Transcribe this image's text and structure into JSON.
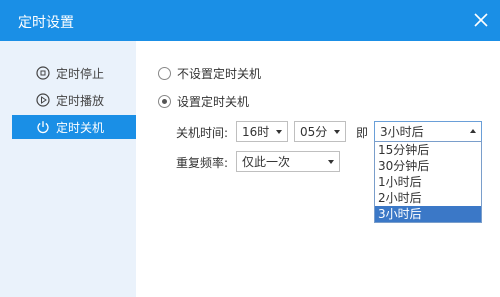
{
  "window": {
    "title": "定时设置"
  },
  "icons": {
    "close": "close-icon",
    "stop": "clock-stop-icon",
    "play": "play-clock-icon",
    "power": "power-icon"
  },
  "colors": {
    "accent": "#1a8fe6",
    "sidebar_bg": "#eaf2fb",
    "selected_option": "#3b78c7"
  },
  "sidebar": {
    "items": [
      {
        "label": "定时停止",
        "active": false
      },
      {
        "label": "定时播放",
        "active": false
      },
      {
        "label": "定时关机",
        "active": true
      }
    ]
  },
  "options": {
    "no_shutdown_label": "不设置定时关机",
    "set_shutdown_label": "设置定时关机",
    "selected": "set_shutdown"
  },
  "shutdown_time": {
    "label": "关机时间:",
    "hour": "16时",
    "minute": "05分",
    "ji_label": "即",
    "relative_value": "3小时后",
    "relative_options": [
      "15分钟后",
      "30分钟后",
      "1小时后",
      "2小时后",
      "3小时后"
    ],
    "relative_selected_index": 4
  },
  "repeat": {
    "label": "重复频率:",
    "value": "仅此一次"
  }
}
